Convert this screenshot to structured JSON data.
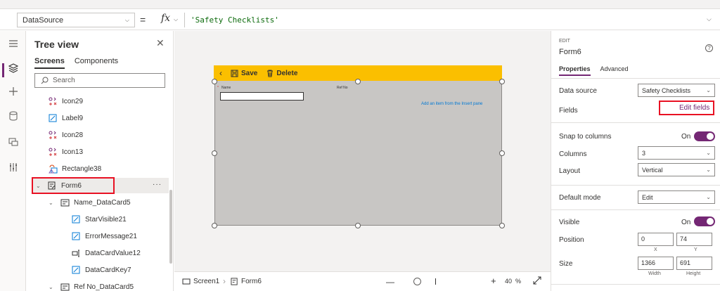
{
  "formula_bar": {
    "property": "DataSource",
    "equals": "=",
    "fx": "fx",
    "formula": "'Safety Checklists'"
  },
  "tree_view": {
    "title": "Tree view",
    "tabs": [
      "Screens",
      "Components"
    ],
    "search_placeholder": "Search",
    "items": [
      {
        "label": "Icon29",
        "icon": "icon-control-icon"
      },
      {
        "label": "Label9",
        "icon": "label-edit-icon"
      },
      {
        "label": "Icon28",
        "icon": "icon-control-icon"
      },
      {
        "label": "Icon13",
        "icon": "icon-control-icon"
      },
      {
        "label": "Rectangle38",
        "icon": "rectangle-shape-icon"
      },
      {
        "label": "Form6",
        "icon": "form-icon"
      },
      {
        "label": "Name_DataCard5",
        "icon": "data-card-icon"
      },
      {
        "label": "StarVisible21",
        "icon": "label-edit-icon"
      },
      {
        "label": "ErrorMessage21",
        "icon": "label-edit-icon"
      },
      {
        "label": "DataCardValue12",
        "icon": "text-input-icon"
      },
      {
        "label": "DataCardKey7",
        "icon": "label-edit-icon"
      },
      {
        "label": "Ref No_DataCard5",
        "icon": "data-card-icon"
      }
    ],
    "more": "···"
  },
  "canvas": {
    "save": "Save",
    "delete": "Delete",
    "field_name": "Name",
    "field_refno": "Ref No",
    "hint": "Add an item from the Insert pane",
    "star": "*"
  },
  "status_bar": {
    "screen": "Screen1",
    "control": "Form6",
    "zoom": "40",
    "zoom_unit": "%"
  },
  "properties": {
    "edit_label": "EDIT",
    "name": "Form6",
    "tabs": [
      "Properties",
      "Advanced"
    ],
    "data_source_label": "Data source",
    "data_source_value": "Safety Checklists",
    "fields_label": "Fields",
    "edit_fields": "Edit fields",
    "snap_label": "Snap to columns",
    "snap_state": "On",
    "columns_label": "Columns",
    "columns_value": "3",
    "layout_label": "Layout",
    "layout_value": "Vertical",
    "default_mode_label": "Default mode",
    "default_mode_value": "Edit",
    "visible_label": "Visible",
    "visible_state": "On",
    "position_label": "Position",
    "pos_x": "0",
    "pos_y": "74",
    "x_label": "X",
    "y_label": "Y",
    "size_label": "Size",
    "width": "1366",
    "height": "691",
    "width_label": "Width",
    "height_label": "Height"
  }
}
